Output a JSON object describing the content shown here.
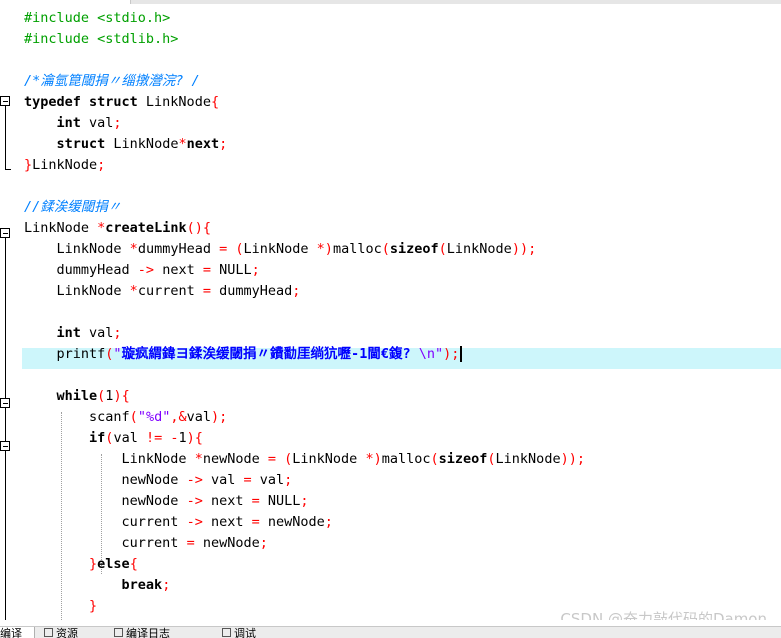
{
  "editor": {
    "watermark": "CSDN @奋力敲代码的Damon"
  },
  "bottom_tabs": [
    {
      "label": "编译"
    },
    {
      "label": "资源"
    },
    {
      "label": "编译日志"
    },
    {
      "label": "调试"
    }
  ],
  "code": [
    [
      [
        "#include <stdio.h>",
        "pp"
      ]
    ],
    [
      [
        "#include <stdlib.h>",
        "pp"
      ]
    ],
    [],
    [
      [
        "/*瀹氫箟閾捐〃缁撴瀯浣? /",
        "cm"
      ]
    ],
    [
      [
        "typedef struct ",
        "kw"
      ],
      [
        "LinkNode",
        ""
      ],
      [
        "{",
        "op"
      ]
    ],
    [
      [
        "    ",
        ""
      ],
      [
        "int",
        "kw"
      ],
      [
        " val",
        ""
      ],
      [
        ";",
        "op"
      ]
    ],
    [
      [
        "    ",
        ""
      ],
      [
        "struct",
        "kw"
      ],
      [
        " LinkNode",
        ""
      ],
      [
        "*",
        "op"
      ],
      [
        "next",
        "kw"
      ],
      [
        ";",
        "op"
      ]
    ],
    [
      [
        "}",
        "op"
      ],
      [
        "LinkNode",
        ""
      ],
      [
        ";",
        "op"
      ]
    ],
    [],
    [
      [
        "//鍒涘缓閾捐〃",
        "cm"
      ]
    ],
    [
      [
        "LinkNode ",
        ""
      ],
      [
        "*",
        "op"
      ],
      [
        "createLink",
        "kw"
      ],
      [
        "(){",
        "op"
      ]
    ],
    [
      [
        "    LinkNode ",
        ""
      ],
      [
        "*",
        "op"
      ],
      [
        "dummyHead ",
        ""
      ],
      [
        "=",
        "op"
      ],
      [
        " ",
        ""
      ],
      [
        "(",
        "op"
      ],
      [
        "LinkNode ",
        ""
      ],
      [
        "*)",
        "op"
      ],
      [
        "malloc",
        ""
      ],
      [
        "(",
        "op"
      ],
      [
        "sizeof",
        "kw"
      ],
      [
        "(",
        "op"
      ],
      [
        "LinkNode",
        ""
      ],
      [
        "));",
        "op"
      ]
    ],
    [
      [
        "    dummyHead ",
        ""
      ],
      [
        "->",
        "op"
      ],
      [
        " next ",
        ""
      ],
      [
        "=",
        "op"
      ],
      [
        " NULL",
        ""
      ],
      [
        ";",
        "op"
      ]
    ],
    [
      [
        "    LinkNode ",
        ""
      ],
      [
        "*",
        "op"
      ],
      [
        "current ",
        ""
      ],
      [
        "=",
        "op"
      ],
      [
        " dummyHead",
        ""
      ],
      [
        ";",
        "op"
      ]
    ],
    [],
    [
      [
        "    ",
        ""
      ],
      [
        "int",
        "kw"
      ],
      [
        " val",
        ""
      ],
      [
        ";",
        "op"
      ]
    ],
    [
      [
        "    printf",
        ""
      ],
      [
        "(",
        "op"
      ],
      [
        "\"",
        "str"
      ],
      [
        "璇疯緭鍏ヨ鍒涘缓閾捐〃鐨勫厓绱犺嚦-1閫€鍑?",
        "strz"
      ],
      [
        " \\n\"",
        "str"
      ],
      [
        ");",
        "op"
      ]
    ],
    [],
    [
      [
        "    ",
        ""
      ],
      [
        "while",
        "kw"
      ],
      [
        "(",
        "op"
      ],
      [
        "1",
        ""
      ],
      [
        "){",
        "op"
      ]
    ],
    [
      [
        "        scanf",
        ""
      ],
      [
        "(",
        "op"
      ],
      [
        "\"%d\"",
        "str"
      ],
      [
        ",&",
        "op"
      ],
      [
        "val",
        ""
      ],
      [
        ");",
        "op"
      ]
    ],
    [
      [
        "        ",
        ""
      ],
      [
        "if",
        "kw"
      ],
      [
        "(",
        "op"
      ],
      [
        "val ",
        ""
      ],
      [
        "!=",
        "op"
      ],
      [
        " ",
        ""
      ],
      [
        "-",
        "op"
      ],
      [
        "1",
        ""
      ],
      [
        "){",
        "op"
      ]
    ],
    [
      [
        "            LinkNode ",
        ""
      ],
      [
        "*",
        "op"
      ],
      [
        "newNode ",
        ""
      ],
      [
        "=",
        "op"
      ],
      [
        " ",
        ""
      ],
      [
        "(",
        "op"
      ],
      [
        "LinkNode ",
        ""
      ],
      [
        "*)",
        "op"
      ],
      [
        "malloc",
        ""
      ],
      [
        "(",
        "op"
      ],
      [
        "sizeof",
        "kw"
      ],
      [
        "(",
        "op"
      ],
      [
        "LinkNode",
        ""
      ],
      [
        "));",
        "op"
      ]
    ],
    [
      [
        "            newNode ",
        ""
      ],
      [
        "->",
        "op"
      ],
      [
        " val ",
        ""
      ],
      [
        "=",
        "op"
      ],
      [
        " val",
        ""
      ],
      [
        ";",
        "op"
      ]
    ],
    [
      [
        "            newNode ",
        ""
      ],
      [
        "->",
        "op"
      ],
      [
        " next ",
        ""
      ],
      [
        "=",
        "op"
      ],
      [
        " NULL",
        ""
      ],
      [
        ";",
        "op"
      ]
    ],
    [
      [
        "            current ",
        ""
      ],
      [
        "->",
        "op"
      ],
      [
        " next ",
        ""
      ],
      [
        "=",
        "op"
      ],
      [
        " newNode",
        ""
      ],
      [
        ";",
        "op"
      ]
    ],
    [
      [
        "            current ",
        ""
      ],
      [
        "=",
        "op"
      ],
      [
        " newNode",
        ""
      ],
      [
        ";",
        "op"
      ]
    ],
    [
      [
        "        ",
        ""
      ],
      [
        "}",
        "op"
      ],
      [
        "else",
        "kw"
      ],
      [
        "{",
        "op"
      ]
    ],
    [
      [
        "            ",
        ""
      ],
      [
        "break",
        "kw"
      ],
      [
        ";",
        "op"
      ]
    ],
    [
      [
        "        ",
        ""
      ],
      [
        "}",
        "op"
      ]
    ]
  ]
}
